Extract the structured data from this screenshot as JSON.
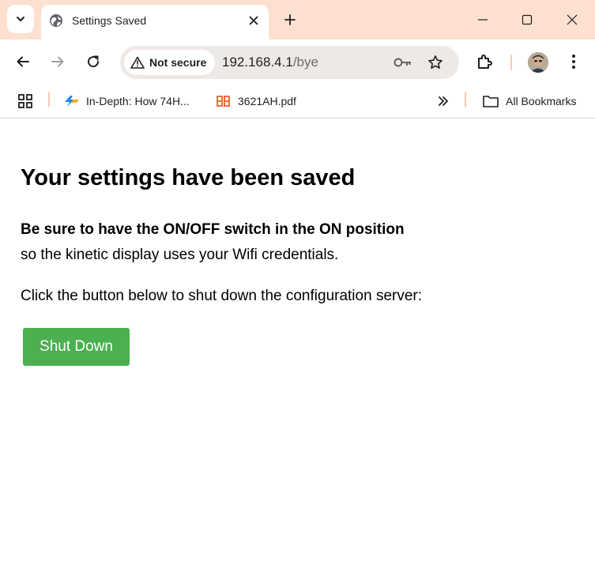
{
  "browser": {
    "tab": {
      "title": "Settings Saved"
    },
    "omnibox": {
      "security_label": "Not secure",
      "url_host": "192.168.4.1",
      "url_path": "/bye"
    },
    "bookmarks": {
      "items": [
        {
          "label": "In-Depth: How 74H..."
        },
        {
          "label": "3621AH.pdf"
        }
      ],
      "all_bookmarks_label": "All Bookmarks"
    },
    "colors": {
      "tabstrip_bg": "#fde0cf",
      "accent_button": "#4caf50"
    }
  },
  "page": {
    "heading": "Your settings have been saved",
    "notice_bold": "Be sure to have the ON/OFF switch in the ON position",
    "notice_rest": "so the kinetic display uses your Wifi credentials.",
    "instruction": "Click the button below to shut down the configuration server:",
    "shutdown_label": "Shut Down"
  }
}
